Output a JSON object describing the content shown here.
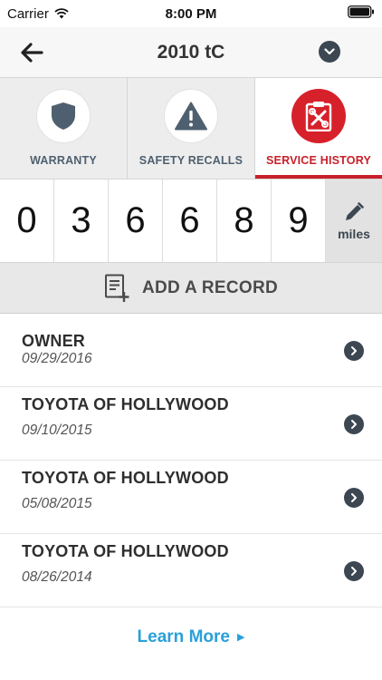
{
  "status_bar": {
    "carrier": "Carrier",
    "time": "8:00 PM",
    "battery": "full"
  },
  "nav": {
    "title": "2010 tC",
    "back_icon": "arrow-left-icon",
    "dropdown_icon": "chevron-down-icon"
  },
  "tabs": [
    {
      "label": "WARRANTY",
      "icon": "shield-icon",
      "active": false
    },
    {
      "label": "SAFETY RECALLS",
      "icon": "warning-icon",
      "active": false
    },
    {
      "label": "SERVICE HISTORY",
      "icon": "tools-clipboard-icon",
      "active": true
    }
  ],
  "odometer": {
    "digits": [
      "0",
      "3",
      "6",
      "6",
      "8",
      "9"
    ],
    "unit": "miles",
    "edit_icon": "pencil-icon"
  },
  "add_record": {
    "label": "ADD A RECORD",
    "icon": "add-document-icon"
  },
  "records": [
    {
      "name": "OWNER",
      "date": "09/29/2016"
    },
    {
      "name": "TOYOTA OF HOLLYWOOD",
      "date": "09/10/2015"
    },
    {
      "name": "TOYOTA OF HOLLYWOOD",
      "date": "05/08/2015"
    },
    {
      "name": "TOYOTA OF HOLLYWOOD",
      "date": "08/26/2014"
    }
  ],
  "learn_more": {
    "label": "Learn More"
  },
  "colors": {
    "accent_red": "#c8202a",
    "link_blue": "#2aa0d8",
    "icon_dark": "#3c4752",
    "tab_text": "#4e6070"
  }
}
